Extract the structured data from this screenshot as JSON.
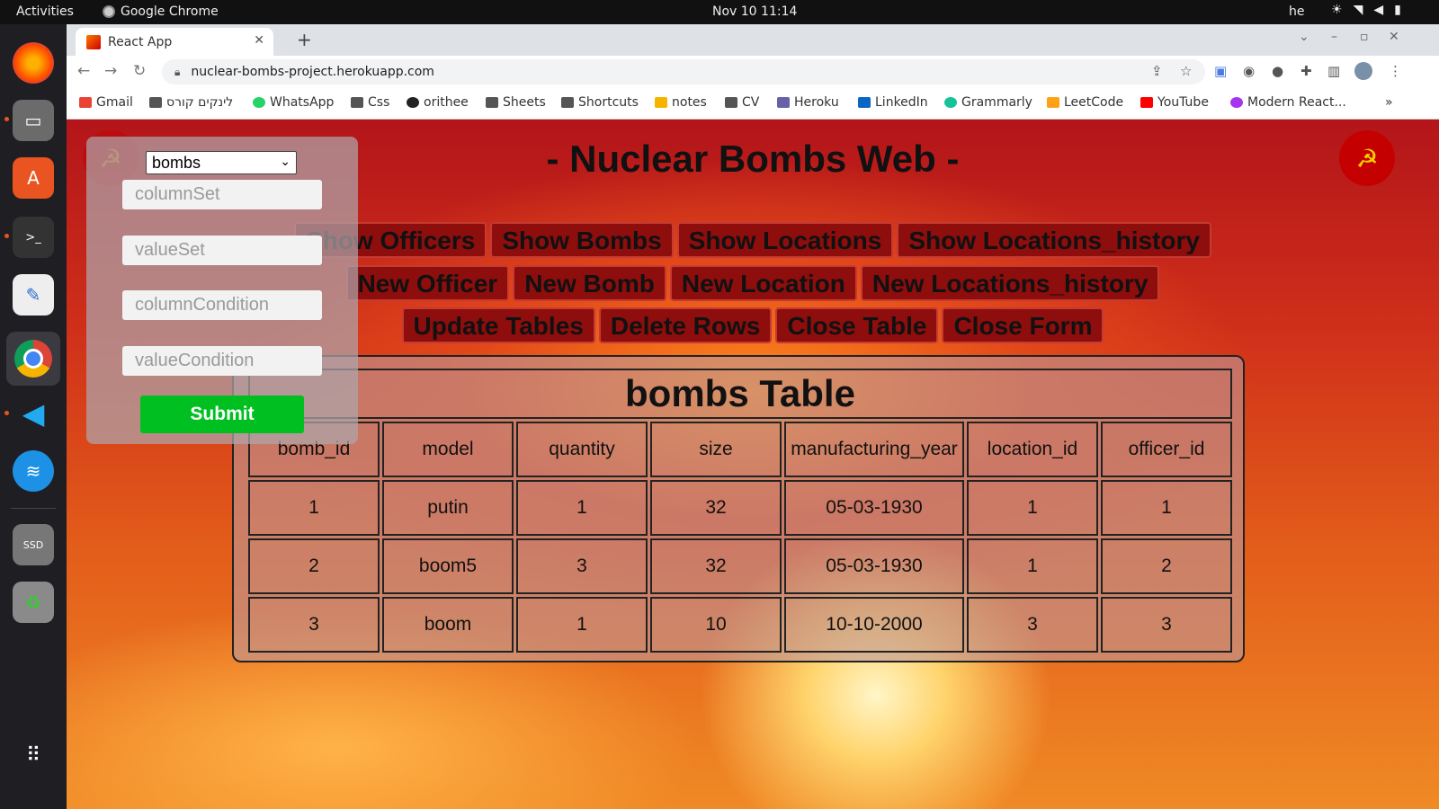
{
  "system": {
    "activities": "Activities",
    "app_name": "Google Chrome",
    "clock": "Nov 10  11:14",
    "lang": "he"
  },
  "browser": {
    "tab_title": "React App",
    "url": "nuclear-bombs-project.herokuapp.com",
    "bookmarks": [
      "Gmail",
      "לינקים קורס",
      "WhatsApp",
      "Css",
      "orithee",
      "Sheets",
      "Shortcuts",
      "notes",
      "CV",
      "Heroku",
      "LinkedIn",
      "Grammarly",
      "LeetCode",
      "YouTube",
      "Modern React..."
    ]
  },
  "page": {
    "title": "- Nuclear Bombs Web -",
    "show_buttons": [
      "Show Officers",
      "Show Bombs",
      "Show Locations",
      "Show Locations_history"
    ],
    "new_buttons": [
      "New Officer",
      "New Bomb",
      "New Location",
      "New Locations_history"
    ],
    "action_buttons": [
      "Update Tables",
      "Delete Rows",
      "Close Table",
      "Close Form"
    ]
  },
  "form": {
    "select_value": "bombs",
    "placeholders": [
      "columnSet",
      "valueSet",
      "columnCondition",
      "valueCondition"
    ],
    "submit_label": "Submit"
  },
  "table": {
    "caption": "bombs Table",
    "headers": [
      "bomb_id",
      "model",
      "quantity",
      "size",
      "manufacturing_year",
      "location_id",
      "officer_id"
    ],
    "rows": [
      [
        "1",
        "putin",
        "1",
        "32",
        "05-03-1930",
        "1",
        "1"
      ],
      [
        "2",
        "boom5",
        "3",
        "32",
        "05-03-1930",
        "1",
        "2"
      ],
      [
        "3",
        "boom",
        "1",
        "10",
        "10-10-2000",
        "3",
        "3"
      ]
    ]
  },
  "colors": {
    "button_bg": "#8e0d0d",
    "submit_bg": "#00c021"
  }
}
